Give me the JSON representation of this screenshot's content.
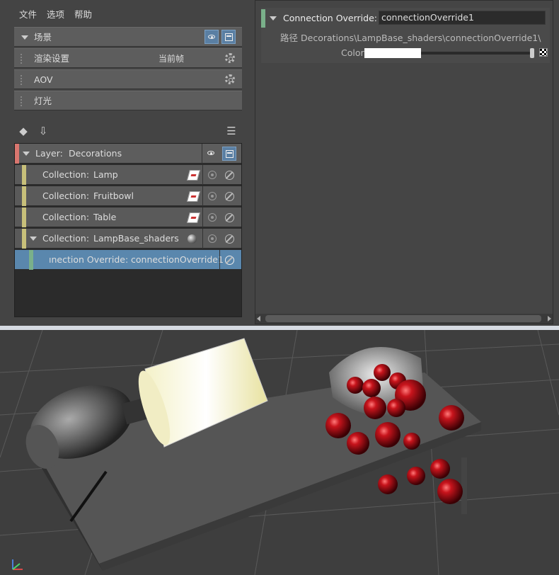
{
  "menu": [
    "文件",
    "选项",
    "帮助"
  ],
  "sections": [
    {
      "label": "场景"
    },
    {
      "label": "渲染设置",
      "sub": "当前帧"
    },
    {
      "label": "AOV"
    },
    {
      "label": "灯光"
    }
  ],
  "layer": {
    "prefix": "Layer:",
    "name": "Decorations"
  },
  "collections": [
    {
      "prefix": "Collection:",
      "name": "Lamp"
    },
    {
      "prefix": "Collection:",
      "name": "Fruitbowl"
    },
    {
      "prefix": "Collection:",
      "name": "Table"
    },
    {
      "prefix": "Collection:",
      "name": "LampBase_shaders"
    }
  ],
  "override_row": {
    "prefix": "ınection Override:",
    "name": "connectionOverride1"
  },
  "attr": {
    "title": "Connection Override:",
    "field_value": "connectionOverride1",
    "path_label": "路径",
    "path": "Decorations\\LampBase_shaders\\connectionOverride1\\",
    "color_label": "Color"
  },
  "colors": {
    "layer_bar": "#d9766f",
    "collection_bar": "#c8c07a",
    "override_bar": "#7ab08a",
    "selected": "#5a87ad"
  }
}
